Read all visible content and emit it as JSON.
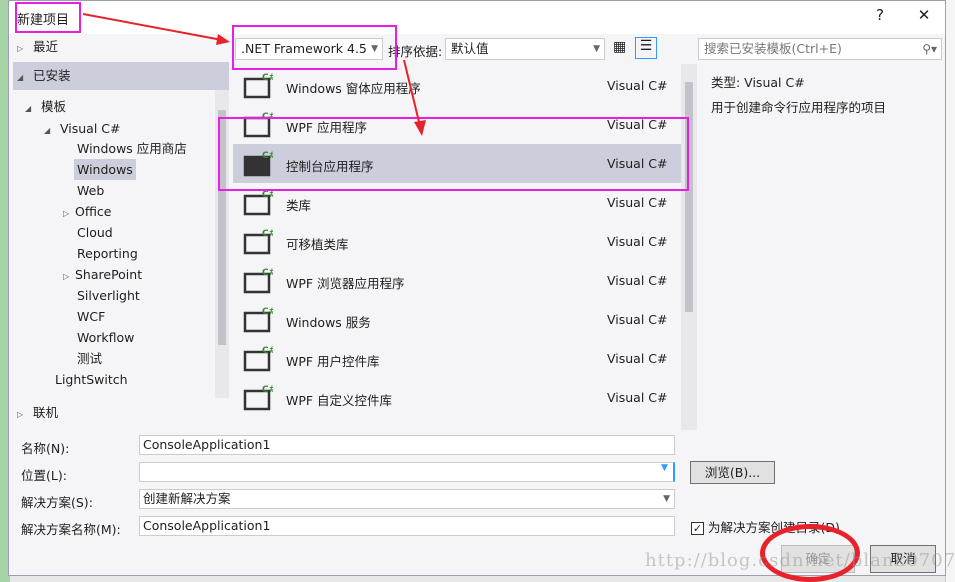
{
  "dialog": {
    "title": "新建项目",
    "help": "?",
    "close": "✕"
  },
  "tree": {
    "recent": "最近",
    "installed": "已安装",
    "templates": "模板",
    "visual_csharp": "Visual C#",
    "children": [
      "Windows 应用商店",
      "Windows",
      "Web",
      "Office",
      "Cloud",
      "Reporting",
      "SharePoint",
      "Silverlight",
      "WCF",
      "Workflow",
      "测试"
    ],
    "lightswitch": "LightSwitch",
    "online": "联机"
  },
  "toolbar": {
    "framework": ".NET Framework 4.5",
    "sort_label": "排序依据:",
    "sort_value": "默认值",
    "search_placeholder": "搜索已安装模板(Ctrl+E)"
  },
  "templates": [
    {
      "name": "Windows 窗体应用程序",
      "lang": "Visual C#"
    },
    {
      "name": "WPF 应用程序",
      "lang": "Visual C#"
    },
    {
      "name": "控制台应用程序",
      "lang": "Visual C#",
      "selected": true
    },
    {
      "name": "类库",
      "lang": "Visual C#"
    },
    {
      "name": "可移植类库",
      "lang": "Visual C#"
    },
    {
      "name": "WPF 浏览器应用程序",
      "lang": "Visual C#"
    },
    {
      "name": "Windows 服务",
      "lang": "Visual C#"
    },
    {
      "name": "WPF 用户控件库",
      "lang": "Visual C#"
    },
    {
      "name": "WPF 自定义控件库",
      "lang": "Visual C#"
    }
  ],
  "details": {
    "type": "类型:  Visual C#",
    "description": "用于创建命令行应用程序的项目"
  },
  "form": {
    "name_label": "名称(N):",
    "name_value": "ConsoleApplication1",
    "location_label": "位置(L):",
    "location_value": "",
    "solution_label": "解决方案(S):",
    "solution_value": "创建新解决方案",
    "solution_name_label": "解决方案名称(M):",
    "solution_name_value": "ConsoleApplication1",
    "browse": "浏览(B)...",
    "create_dir": "为解决方案创建目录(D)",
    "create_dir_checked": true
  },
  "buttons": {
    "ok": "确定",
    "cancel": "取消"
  },
  "watermark": "http://blog.csdn.net/blank0707",
  "colors": {
    "highlight": "#e61ee6",
    "annotation": "#e8222a",
    "selection": "#cccedb"
  }
}
